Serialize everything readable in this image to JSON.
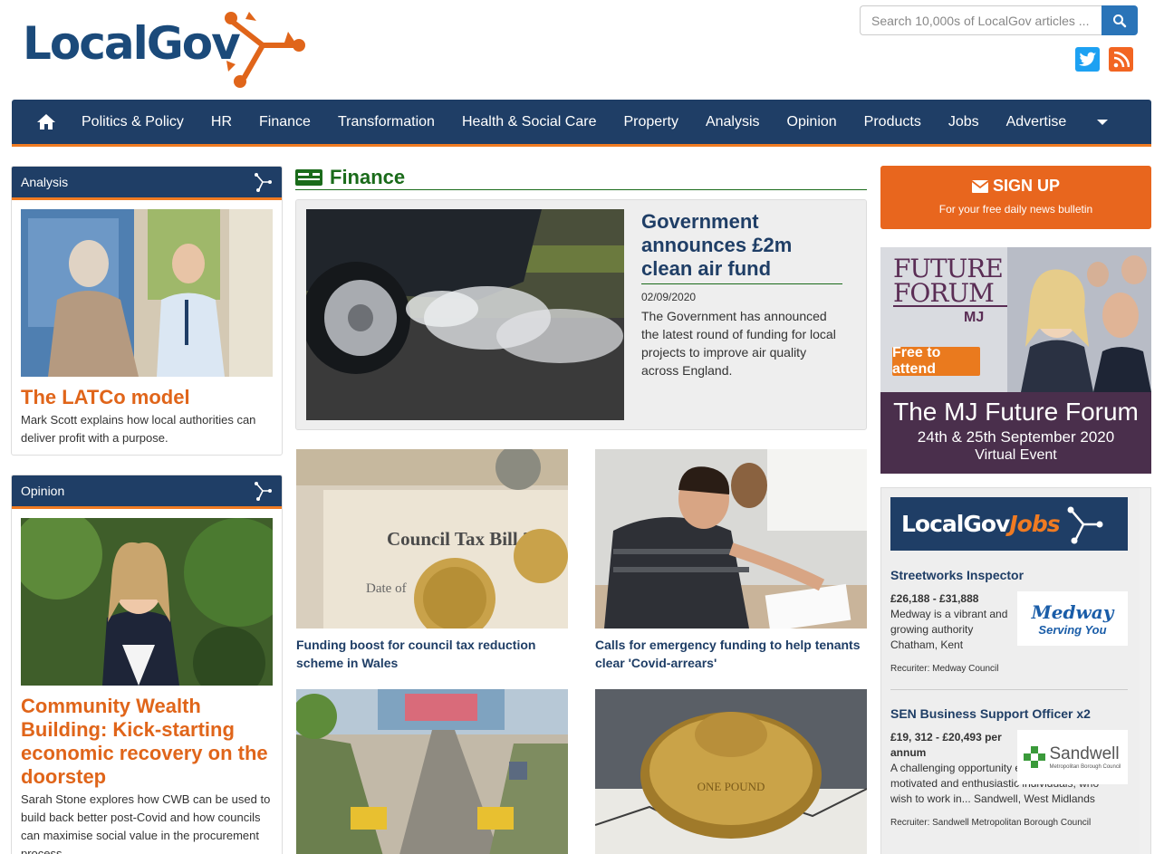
{
  "header": {
    "logo_text": "LocalGov",
    "search_placeholder": "Search 10,000s of LocalGov articles ...",
    "icons": [
      "search-icon",
      "twitter-icon",
      "rss-icon"
    ]
  },
  "nav": {
    "items": [
      "Politics & Policy",
      "HR",
      "Finance",
      "Transformation",
      "Health & Social Care",
      "Property",
      "Analysis",
      "Opinion",
      "Products",
      "Jobs",
      "Advertise"
    ],
    "colors": {
      "bar": "#1f3e66",
      "accent": "#f07b22"
    }
  },
  "analysis": {
    "header": "Analysis",
    "title": "The LATCo model",
    "desc": "Mark Scott explains how local authorities can deliver profit with a purpose."
  },
  "opinion": {
    "header": "Opinion",
    "title": "Community Wealth Building: Kick-starting economic recovery on the doorstep",
    "desc": "Sarah Stone explores how CWB can be used to build back better post-Covid and how councils can maximise social value in the procurement process."
  },
  "finance": {
    "section_title": "Finance",
    "feature": {
      "title": "Government announces £2m clean air fund",
      "date": "02/09/2020",
      "desc": "The Government has announced the latest round of funding for local projects to improve air quality across England."
    },
    "tiles": [
      {
        "title": "Funding boost for council tax reduction scheme in Wales",
        "image_text": "Council Tax Bill 20"
      },
      {
        "title": "Calls for emergency funding to help tenants clear 'Covid-arrears'"
      },
      {
        "title": ""
      },
      {
        "title": ""
      }
    ]
  },
  "signup": {
    "title": "SIGN UP",
    "sub": "For your free daily news bulletin"
  },
  "ad": {
    "line1": "FUTURE",
    "line2": "FORUM",
    "brand": "MJ",
    "free": "Free to attend",
    "name": "The MJ Future Forum",
    "dates": "24th & 25th September 2020",
    "virtual": "Virtual Event"
  },
  "jobs": {
    "logo_main": "LocalGov",
    "logo_accent": "Jobs",
    "items": [
      {
        "title": "Streetworks Inspector",
        "salary": "£26,188 - £31,888",
        "desc": "Medway is a vibrant and growing authority Chatham, Kent",
        "recruiter": "Recuriter: Medway Council",
        "logo_name": "Medway",
        "logo_sub": "Serving You"
      },
      {
        "title": "SEN Business Support Officer x2",
        "salary": "£19, 312 - £20,493 per annum",
        "desc": "A challenging opportunity exists for highly motivated and enthusiastic individuals, who wish to work in... Sandwell, West Midlands",
        "recruiter": "Recruiter: Sandwell Metropolitan Borough Council",
        "logo_name": "Sandwell",
        "logo_sub": "Metropolitan Borough Council"
      }
    ]
  }
}
